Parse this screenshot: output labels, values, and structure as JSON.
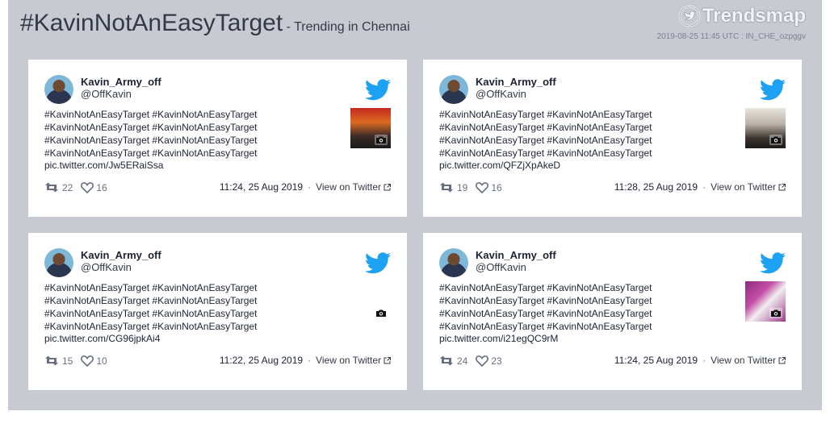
{
  "header": {
    "hashtag": "#KavinNotAnEasyTarget",
    "subtitle": "- Trending in Chennai",
    "logo_text": "Trendsmap",
    "meta": "2019-08-25 11:45 UTC : IN_CHE_ozpggv"
  },
  "colors": {
    "background_panel": "#c8cad2",
    "twitter_blue": "#1da1f2",
    "text": "#1c2233"
  },
  "tweets": [
    {
      "name": "Kavin_Army_off",
      "handle": "@OffKavin",
      "text": "#KavinNotAnEasyTarget #KavinNotAnEasyTarget #KavinNotAnEasyTarget #KavinNotAnEasyTarget #KavinNotAnEasyTarget #KavinNotAnEasyTarget #KavinNotAnEasyTarget #KavinNotAnEasyTarget",
      "link": "pic.twitter.com/Jw5ERaiSsa",
      "retweets": "22",
      "likes": "16",
      "time": "11:24, 25 Aug 2019",
      "view_label": "View on Twitter",
      "media_icon": "camera-icon"
    },
    {
      "name": "Kavin_Army_off",
      "handle": "@OffKavin",
      "text": "#KavinNotAnEasyTarget #KavinNotAnEasyTarget #KavinNotAnEasyTarget #KavinNotAnEasyTarget #KavinNotAnEasyTarget #KavinNotAnEasyTarget #KavinNotAnEasyTarget #KavinNotAnEasyTarget",
      "link": "pic.twitter.com/QFZjXpAkeD",
      "retweets": "19",
      "likes": "16",
      "time": "11:28, 25 Aug 2019",
      "view_label": "View on Twitter",
      "media_icon": "camera-icon"
    },
    {
      "name": "Kavin_Army_off",
      "handle": "@OffKavin",
      "text": "#KavinNotAnEasyTarget #KavinNotAnEasyTarget #KavinNotAnEasyTarget #KavinNotAnEasyTarget #KavinNotAnEasyTarget #KavinNotAnEasyTarget #KavinNotAnEasyTarget #KavinNotAnEasyTarget",
      "link": "pic.twitter.com/CG96jpkAi4",
      "retweets": "15",
      "likes": "10",
      "time": "11:22, 25 Aug 2019",
      "view_label": "View on Twitter",
      "media_icon": "camera-icon"
    },
    {
      "name": "Kavin_Army_off",
      "handle": "@OffKavin",
      "text": "#KavinNotAnEasyTarget #KavinNotAnEasyTarget #KavinNotAnEasyTarget #KavinNotAnEasyTarget #KavinNotAnEasyTarget #KavinNotAnEasyTarget #KavinNotAnEasyTarget #KavinNotAnEasyTarget",
      "link": "pic.twitter.com/i21egQC9rM",
      "retweets": "24",
      "likes": "23",
      "time": "11:24, 25 Aug 2019",
      "view_label": "View on Twitter",
      "media_icon": "camera-icon"
    }
  ]
}
